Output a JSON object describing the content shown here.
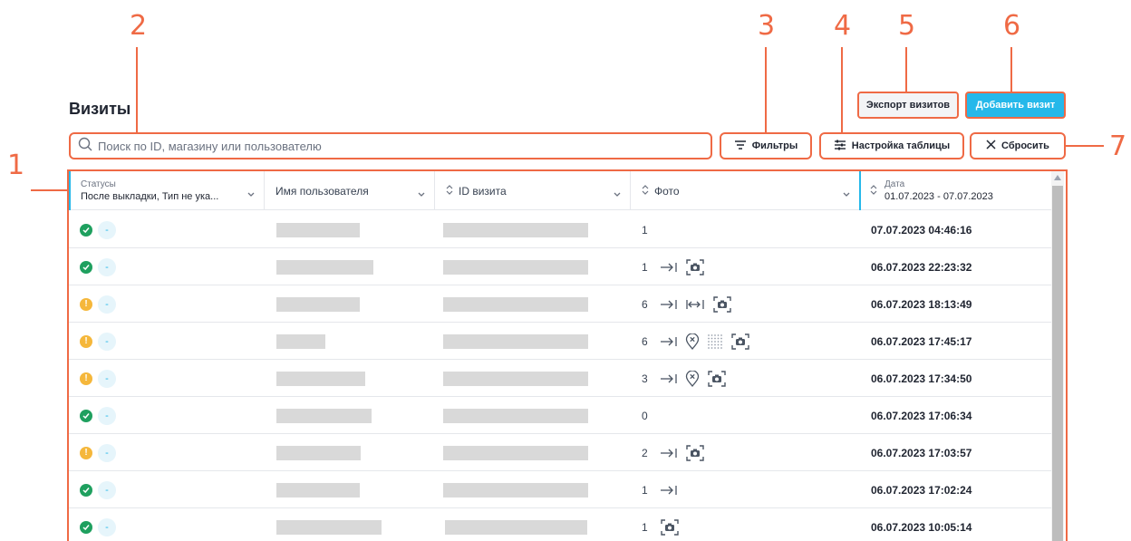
{
  "callouts": [
    "1",
    "2",
    "3",
    "4",
    "5",
    "6",
    "7"
  ],
  "accent_color": "#ef6a45",
  "brand_color": "#25b8ea",
  "page": {
    "title": "Визиты"
  },
  "actions": {
    "export_label": "Экспорт визитов",
    "add_label": "Добавить визит"
  },
  "search": {
    "placeholder": "Поиск по ID, магазину или пользователю"
  },
  "toolbar": {
    "filters_label": "Фильтры",
    "settings_label": "Настройка таблицы",
    "reset_label": "Сбросить"
  },
  "table": {
    "columns": {
      "status": {
        "label": "Статусы",
        "value": "После выкладки, Тип не ука..."
      },
      "name": {
        "label": "Имя пользователя"
      },
      "id": {
        "label": "ID визита"
      },
      "photo": {
        "label": "Фото"
      },
      "date": {
        "label": "Дата",
        "value": "01.07.2023 - 07.07.2023"
      }
    },
    "rows": [
      {
        "status": "ok",
        "type": "-",
        "photo_count": "1",
        "icons": [],
        "date": "07.07.2023 04:46:16"
      },
      {
        "status": "ok",
        "type": "-",
        "photo_count": "1",
        "icons": [
          "arrow-to-line",
          "camera"
        ],
        "date": "06.07.2023 22:23:32"
      },
      {
        "status": "warning",
        "type": "-",
        "photo_count": "6",
        "icons": [
          "arrow-to-line",
          "arrows-between",
          "camera"
        ],
        "date": "06.07.2023 18:13:49"
      },
      {
        "status": "warning",
        "type": "-",
        "photo_count": "6",
        "icons": [
          "arrow-to-line",
          "location-x",
          "grid-dots",
          "camera"
        ],
        "date": "06.07.2023 17:45:17"
      },
      {
        "status": "warning",
        "type": "-",
        "photo_count": "3",
        "icons": [
          "arrow-to-line",
          "location-x",
          "camera"
        ],
        "date": "06.07.2023 17:34:50"
      },
      {
        "status": "ok",
        "type": "-",
        "photo_count": "0",
        "icons": [],
        "date": "06.07.2023 17:06:34"
      },
      {
        "status": "warning",
        "type": "-",
        "photo_count": "2",
        "icons": [
          "arrow-to-line",
          "camera"
        ],
        "date": "06.07.2023 17:03:57"
      },
      {
        "status": "ok",
        "type": "-",
        "photo_count": "1",
        "icons": [
          "arrow-to-line"
        ],
        "date": "06.07.2023 17:02:24"
      },
      {
        "status": "ok",
        "type": "-",
        "photo_count": "1",
        "icons": [
          "camera"
        ],
        "date": "06.07.2023 10:05:14"
      }
    ]
  }
}
